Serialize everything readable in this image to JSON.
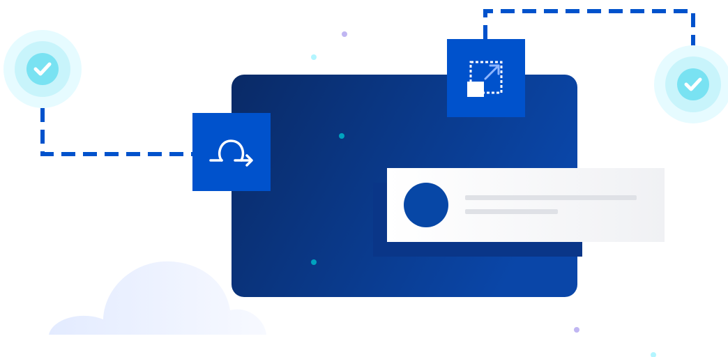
{
  "illustration": {
    "theme": "workflow-automation",
    "colors": {
      "panel_dark": "#0a2a66",
      "panel_light": "#0a46a8",
      "tile_blue": "#0052cc",
      "connector": "#0052cc",
      "check_glow": "#e6fbff",
      "check_ring": "#c8f4fb",
      "check_fill": "#79e2f2",
      "card_bg": "#f4f5f7",
      "card_shadow": "#0a3688",
      "skeleton_line": "#dfe1e6",
      "avatar": "#0747a6",
      "cloud": "#e9efff",
      "dot_teal": "#00a3bf",
      "dot_purple": "#c0b6f2",
      "dot_cyan": "#b3f5ff"
    },
    "icons": [
      "check-icon",
      "loop-arrow-icon",
      "resize-icon",
      "check-icon"
    ],
    "card": {
      "avatar": "circle",
      "skeleton_lines": 2
    }
  }
}
